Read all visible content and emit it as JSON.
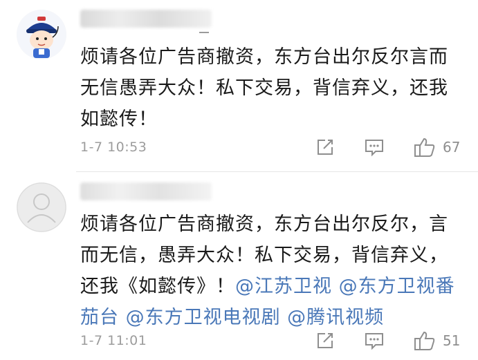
{
  "comments": [
    {
      "text": "烦请各位广告商撤资，东方台出尔反尔言而无信愚弄大众！私下交易，背信弃义，还我如懿传！",
      "time": "1-7 10:53",
      "likes": "67"
    },
    {
      "text_lines": [
        "烦请各位广告商撤资，东方台出尔反尔，言",
        "而无信，愚弄大众！私下交易，背信弃义，",
        "还我《如懿传》！"
      ],
      "mentions": [
        "@江苏卫视",
        "@东方卫视番茄台",
        "@东方卫视电视剧",
        "@腾讯视频"
      ],
      "mention_line3": "@江苏卫视 @东方卫视番",
      "mention_line4a": "茄台 @东方卫视电视剧 @腾讯视频",
      "time": "1-7 11:01",
      "likes": "51"
    }
  ],
  "c1_lines": [
    "烦请各位广告商撤资，东方台出尔反尔言而",
    "无信愚弄大众！私下交易，背信弃义，还我",
    "如懿传！"
  ],
  "icons": {
    "avatar1": "cartoon-avatar-icon",
    "avatar2": "default-avatar-icon",
    "share": "share-icon",
    "reply": "comment-icon",
    "like": "thumbs-up-icon"
  },
  "colors": {
    "mention": "#4a78b8",
    "meta": "#9c9c9c"
  }
}
